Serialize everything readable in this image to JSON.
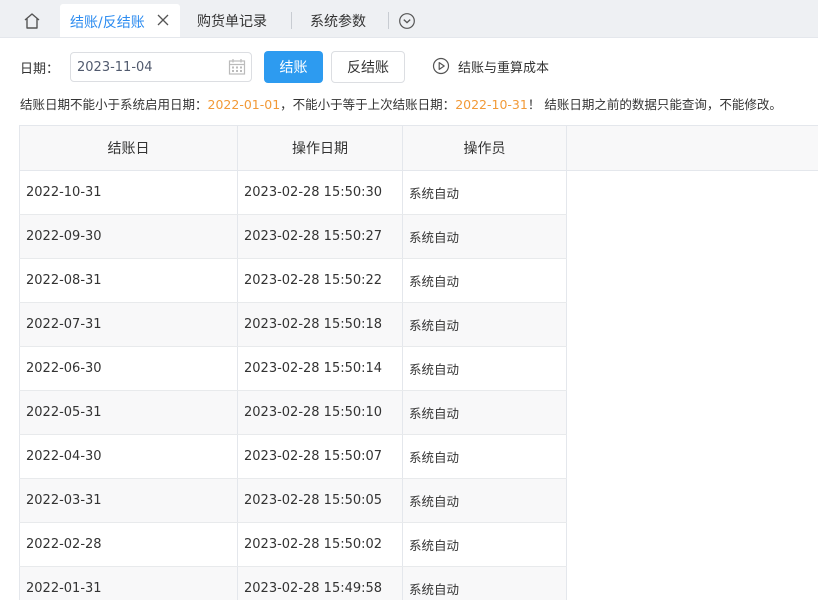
{
  "tabs": {
    "home_icon": "home-icon",
    "active": {
      "label": "结账/反结账",
      "close_icon": "close-icon"
    },
    "items": [
      "购货单记录",
      "系统参数"
    ],
    "more_icon": "chevron-down-circle-icon"
  },
  "toolbar": {
    "date_label": "日期：",
    "date_value": "2023-11-04",
    "calendar_icon": "calendar-icon",
    "checkout_button": "结账",
    "reverse_checkout_button": "反结账",
    "recalc_link": "结账与重算成本",
    "recalc_icon": "play-circle-icon"
  },
  "notice": {
    "part1": "结账日期不能小于系统启用日期：",
    "start_date": "2022-01-01",
    "part2": "，不能小于等于上次结账日期：",
    "last_date": "2022-10-31",
    "part3": "！ 结账日期之前的数据只能查询，不能修改。",
    "highlight_color": "#f29a38"
  },
  "table": {
    "columns": [
      "结账日",
      "操作日期",
      "操作员"
    ],
    "rows": [
      [
        "2022-10-31",
        "2023-02-28 15:50:30",
        "系统自动"
      ],
      [
        "2022-09-30",
        "2023-02-28 15:50:27",
        "系统自动"
      ],
      [
        "2022-08-31",
        "2023-02-28 15:50:22",
        "系统自动"
      ],
      [
        "2022-07-31",
        "2023-02-28 15:50:18",
        "系统自动"
      ],
      [
        "2022-06-30",
        "2023-02-28 15:50:14",
        "系统自动"
      ],
      [
        "2022-05-31",
        "2023-02-28 15:50:10",
        "系统自动"
      ],
      [
        "2022-04-30",
        "2023-02-28 15:50:07",
        "系统自动"
      ],
      [
        "2022-03-31",
        "2023-02-28 15:50:05",
        "系统自动"
      ],
      [
        "2022-02-28",
        "2023-02-28 15:50:02",
        "系统自动"
      ],
      [
        "2022-01-31",
        "2023-02-28 15:49:58",
        "系统自动"
      ]
    ]
  },
  "colors": {
    "accent": "#2d9bf0",
    "tab_active_text": "#2d8cf0"
  }
}
